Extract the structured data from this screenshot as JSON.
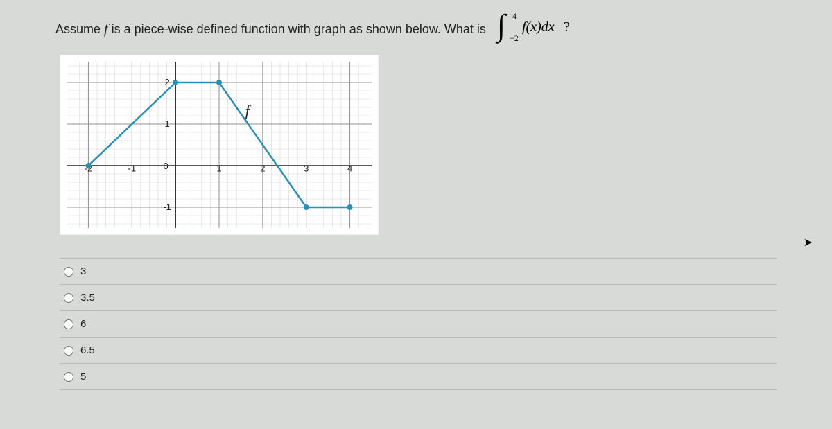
{
  "question": {
    "prefix": "Assume  ",
    "func": "f",
    "middle": "  is a piece-wise defined function with graph as shown below.  What is  ",
    "integral_lower": "−2",
    "integral_upper": "4",
    "integrand": "f(x)dx",
    "suffix": " ?"
  },
  "chart_data": {
    "type": "line",
    "title": "",
    "xlabel": "",
    "ylabel": "",
    "xlim": [
      -2.5,
      4.5
    ],
    "ylim": [
      -1.5,
      2.5
    ],
    "x_ticks": [
      -2,
      -1,
      0,
      1,
      2,
      3,
      4
    ],
    "y_ticks": [
      -1,
      0,
      1,
      2
    ],
    "minor_grid": true,
    "function_label": "f",
    "segments": [
      {
        "points": [
          [
            -2,
            0
          ],
          [
            0,
            2
          ]
        ],
        "left_closed": true,
        "right_closed": true
      },
      {
        "points": [
          [
            0,
            2
          ],
          [
            1,
            2
          ]
        ],
        "left_closed": true,
        "right_closed": true
      },
      {
        "points": [
          [
            1,
            2
          ],
          [
            3,
            -1
          ]
        ],
        "left_closed": true,
        "right_closed": true
      },
      {
        "points": [
          [
            3,
            -1
          ],
          [
            4,
            -1
          ]
        ],
        "left_closed": true,
        "right_closed": true
      }
    ]
  },
  "options": [
    {
      "id": "opt1",
      "label": "3"
    },
    {
      "id": "opt2",
      "label": "3.5"
    },
    {
      "id": "opt3",
      "label": "6"
    },
    {
      "id": "opt4",
      "label": "6.5"
    },
    {
      "id": "opt5",
      "label": "5"
    }
  ]
}
